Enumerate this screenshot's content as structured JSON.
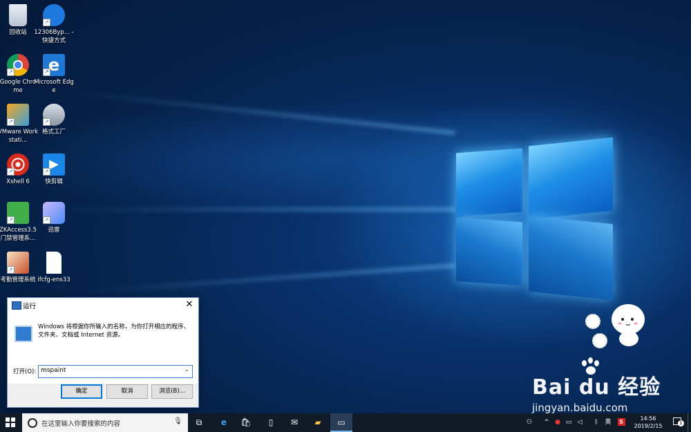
{
  "desktop": {
    "icons": [
      {
        "label": "回收站",
        "icon": "recycle-bin-icon"
      },
      {
        "label": "12306Byp... - 快捷方式",
        "icon": "12306bypass-icon"
      },
      {
        "label": "Google Chrome",
        "icon": "chrome-icon"
      },
      {
        "label": "Microsoft Edge",
        "icon": "edge-icon"
      },
      {
        "label": "VMware Workstati...",
        "icon": "vmware-icon"
      },
      {
        "label": "格式工厂",
        "icon": "format-factory-icon"
      },
      {
        "label": "Xshell 6",
        "icon": "xshell-icon"
      },
      {
        "label": "快剪辑",
        "icon": "kuaijianji-icon"
      },
      {
        "label": "ZKAccess3.5 门禁管理系...",
        "icon": "zkaccess-icon"
      },
      {
        "label": "迅雷",
        "icon": "xunlei-icon"
      },
      {
        "label": "考勤管理系统",
        "icon": "attendance-icon"
      },
      {
        "label": "ifcfg-ens33",
        "icon": "file-icon"
      }
    ]
  },
  "run_dialog": {
    "title": "运行",
    "close": "✕",
    "description": "Windows 将根据你所输入的名称，为你打开相应的程序、文件夹、文档或 Internet 资源。",
    "open_label": "打开(O):",
    "open_value": "mspaint",
    "buttons": {
      "ok": "确定",
      "cancel": "取消",
      "browse": "浏览(B)..."
    }
  },
  "taskbar": {
    "search_placeholder": "在这里输入你要搜索的内容",
    "ime": "英",
    "time": "14:56",
    "date": "2019/2/15",
    "notification_count": "1"
  },
  "watermark": {
    "brand": "Bai du 经验",
    "url": "jingyan.baidu.com"
  },
  "colors": {
    "accent": "#0078d7",
    "taskbar": "#111a27",
    "desktop": "#06244f"
  }
}
